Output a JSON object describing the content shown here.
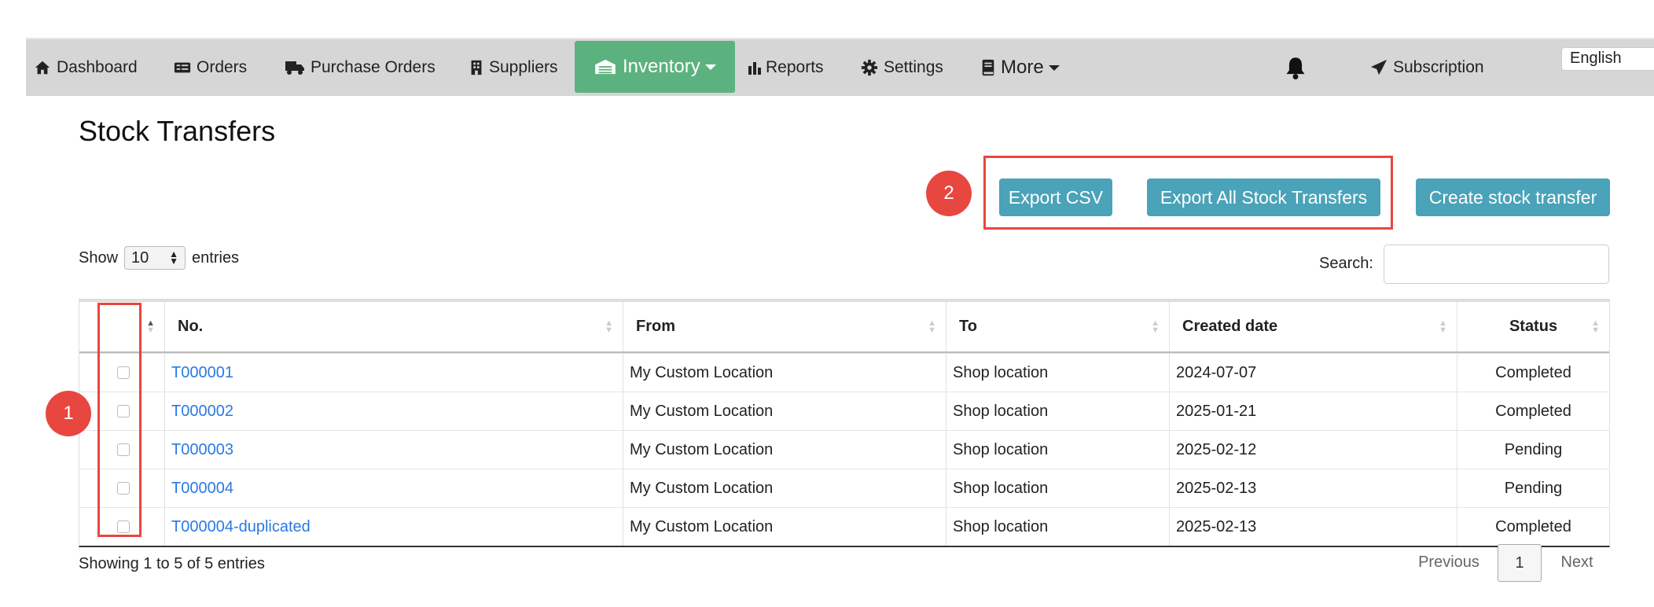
{
  "nav": {
    "items": [
      {
        "label": "Dashboard",
        "icon": "home-icon"
      },
      {
        "label": "Orders",
        "icon": "orders-icon"
      },
      {
        "label": "Purchase Orders",
        "icon": "truck-icon"
      },
      {
        "label": "Suppliers",
        "icon": "building-icon"
      },
      {
        "label": "Inventory",
        "icon": "warehouse-icon"
      },
      {
        "label": "Reports",
        "icon": "bar-chart-icon"
      },
      {
        "label": "Settings",
        "icon": "gear-icon"
      },
      {
        "label": "More",
        "icon": "book-icon"
      },
      {
        "label": "Subscription",
        "icon": "paper-plane-icon"
      }
    ],
    "active_color": "#5cb27e",
    "language": "English"
  },
  "page": {
    "title": "Stock Transfers"
  },
  "actions": {
    "export_csv": "Export CSV",
    "export_all": "Export All Stock Transfers",
    "create": "Create stock transfer",
    "button_color": "#4aa3b8"
  },
  "annotations": {
    "callout_1": "1",
    "callout_2": "2",
    "color": "#e8473f"
  },
  "table_controls": {
    "show_label": "Show",
    "page_length": "10",
    "entries_label": "entries",
    "search_label": "Search:",
    "search_value": ""
  },
  "table": {
    "columns": [
      "No.",
      "From",
      "To",
      "Created date",
      "Status"
    ],
    "rows": [
      {
        "no": "T000001",
        "from": "My Custom Location",
        "to": "Shop location",
        "created": "2024-07-07",
        "status": "Completed"
      },
      {
        "no": "T000002",
        "from": "My Custom Location",
        "to": "Shop location",
        "created": "2025-01-21",
        "status": "Completed"
      },
      {
        "no": "T000003",
        "from": "My Custom Location",
        "to": "Shop location",
        "created": "2025-02-12",
        "status": "Pending"
      },
      {
        "no": "T000004",
        "from": "My Custom Location",
        "to": "Shop location",
        "created": "2025-02-13",
        "status": "Pending"
      },
      {
        "no": "T000004-duplicated",
        "from": "My Custom Location",
        "to": "Shop location",
        "created": "2025-02-13",
        "status": "Completed"
      }
    ]
  },
  "footer": {
    "info": "Showing 1 to 5 of 5 entries",
    "previous": "Previous",
    "current_page": "1",
    "next": "Next"
  }
}
